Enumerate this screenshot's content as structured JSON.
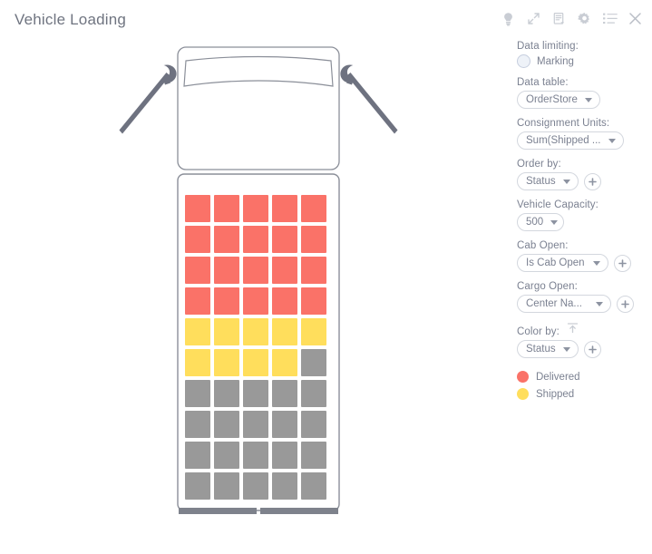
{
  "title": "Vehicle Loading",
  "toolbar": {
    "items": [
      {
        "name": "lightbulb-icon",
        "label": "Insights"
      },
      {
        "name": "maximize-icon",
        "label": "Maximize"
      },
      {
        "name": "export-icon",
        "label": "Export"
      },
      {
        "name": "gear-icon",
        "label": "Properties"
      },
      {
        "name": "list-icon",
        "label": "Details"
      },
      {
        "name": "close-icon",
        "label": "Close"
      }
    ]
  },
  "panel": {
    "data_limiting": {
      "label": "Data limiting:",
      "marking_label": "Marking",
      "marking_selected": false
    },
    "data_table": {
      "label": "Data table:",
      "value": "OrderStore"
    },
    "consignment_units": {
      "label": "Consignment Units:",
      "value": "Sum(Shipped ..."
    },
    "order_by": {
      "label": "Order by:",
      "value": "Status",
      "add_label": "+"
    },
    "vehicle_capacity": {
      "label": "Vehicle Capacity:",
      "value": "500"
    },
    "cab_open": {
      "label": "Cab Open:",
      "value": "Is Cab Open",
      "add_label": "+"
    },
    "cargo_open": {
      "label": "Cargo Open:",
      "value": "Center Na...",
      "add_label": "+"
    },
    "color_by": {
      "label": "Color by:",
      "value": "Status",
      "add_label": "+",
      "sort_icon": "sort-ascending-icon"
    },
    "legend": [
      {
        "label": "Delivered",
        "color": "#FA7268"
      },
      {
        "label": "Shipped",
        "color": "#FFDE5C"
      }
    ]
  },
  "chart_data": {
    "type": "heatmap",
    "title": "Vehicle Loading",
    "description": "Top-down schematic of a truck showing cargo slots colored by order status",
    "rows": 10,
    "columns": 5,
    "categories": [
      "Delivered",
      "Shipped",
      "Empty"
    ],
    "colors": {
      "Delivered": "#FA7268",
      "Shipped": "#FFDE5C",
      "Empty": "#999999"
    },
    "counts": {
      "Delivered": 20,
      "Shipped": 9,
      "Empty": 21
    },
    "cells": [
      [
        "Delivered",
        "Delivered",
        "Delivered",
        "Delivered",
        "Delivered"
      ],
      [
        "Delivered",
        "Delivered",
        "Delivered",
        "Delivered",
        "Delivered"
      ],
      [
        "Delivered",
        "Delivered",
        "Delivered",
        "Delivered",
        "Delivered"
      ],
      [
        "Delivered",
        "Delivered",
        "Delivered",
        "Delivered",
        "Delivered"
      ],
      [
        "Shipped",
        "Shipped",
        "Shipped",
        "Shipped",
        "Shipped"
      ],
      [
        "Shipped",
        "Shipped",
        "Shipped",
        "Shipped",
        "Empty"
      ],
      [
        "Empty",
        "Empty",
        "Empty",
        "Empty",
        "Empty"
      ],
      [
        "Empty",
        "Empty",
        "Empty",
        "Empty",
        "Empty"
      ],
      [
        "Empty",
        "Empty",
        "Empty",
        "Empty",
        "Empty"
      ],
      [
        "Empty",
        "Empty",
        "Empty",
        "Empty",
        "Empty"
      ]
    ]
  }
}
